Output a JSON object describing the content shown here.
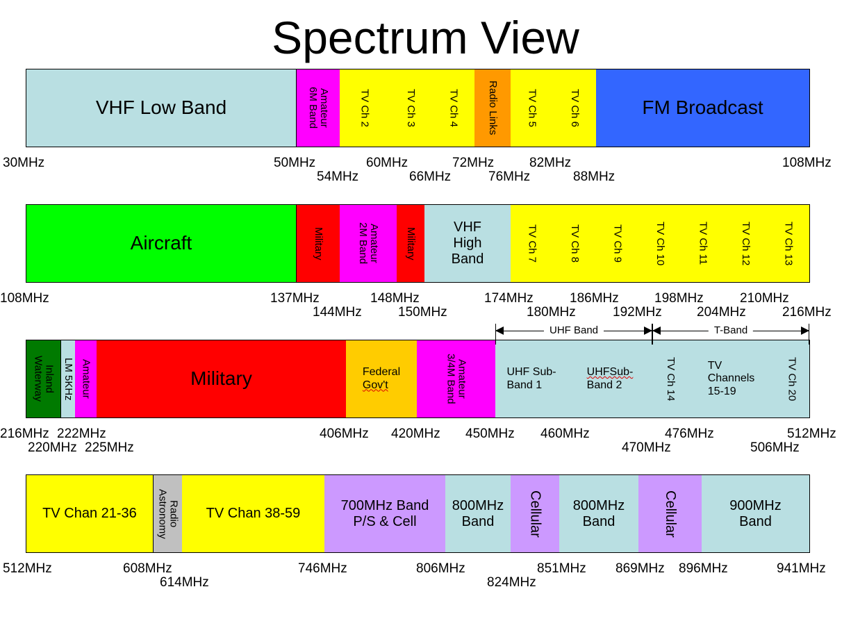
{
  "title": "Spectrum View",
  "colors": {
    "light_blue": "#b9dfe2",
    "magenta": "#ff00ff",
    "yellow": "#ffff00",
    "orange": "#ff9900",
    "fm_blue": "#3366ff",
    "green": "#00ff00",
    "red": "#ff0000",
    "dark_green": "#007a00",
    "gold": "#ffcc00",
    "lavender": "#cc99ff",
    "gray": "#c0c0c0"
  },
  "rows": [
    {
      "range": [
        "30MHz",
        "108MHz"
      ],
      "segments": [
        {
          "label": "VHF Low Band",
          "color": "light_blue",
          "orient": "horizontal",
          "size": "big"
        },
        {
          "label": "Amateur\n6M Band",
          "color": "magenta",
          "orient": "vertical"
        },
        {
          "label": "TV Ch 2",
          "color": "yellow",
          "orient": "vertical"
        },
        {
          "label": "TV Ch 3",
          "color": "yellow",
          "orient": "vertical"
        },
        {
          "label": "TV Ch 4",
          "color": "yellow",
          "orient": "vertical"
        },
        {
          "label": "Radio Links",
          "color": "orange",
          "orient": "vertical"
        },
        {
          "label": "TV Ch 5",
          "color": "yellow",
          "orient": "vertical"
        },
        {
          "label": "TV Ch 6",
          "color": "yellow",
          "orient": "vertical"
        },
        {
          "label": "FM Broadcast",
          "color": "fm_blue",
          "orient": "horizontal",
          "size": "big"
        }
      ],
      "freq_upper": [
        "30MHz",
        "50MHz",
        "60MHz",
        "72MHz",
        "82MHz",
        "108MHz"
      ],
      "freq_lower": [
        "54MHz",
        "66MHz",
        "76MHz",
        "88MHz"
      ]
    },
    {
      "range": [
        "108MHz",
        "216MHz"
      ],
      "segments": [
        {
          "label": "Aircraft",
          "color": "green",
          "orient": "horizontal",
          "size": "big"
        },
        {
          "label": "Military",
          "color": "red",
          "orient": "vertical"
        },
        {
          "label": "Amateur\n2M Band",
          "color": "magenta",
          "orient": "vertical"
        },
        {
          "label": "Military",
          "color": "red",
          "orient": "vertical"
        },
        {
          "label": "VHF\nHigh\nBand",
          "color": "light_blue",
          "orient": "horizontal",
          "size": "med"
        },
        {
          "label": "TV Ch 7",
          "color": "yellow",
          "orient": "vertical"
        },
        {
          "label": "TV Ch 8",
          "color": "yellow",
          "orient": "vertical"
        },
        {
          "label": "TV Ch 9",
          "color": "yellow",
          "orient": "vertical"
        },
        {
          "label": "TV Ch 10",
          "color": "yellow",
          "orient": "vertical"
        },
        {
          "label": "TV Ch 11",
          "color": "yellow",
          "orient": "vertical"
        },
        {
          "label": "TV Ch 12",
          "color": "yellow",
          "orient": "vertical"
        },
        {
          "label": "TV Ch 13",
          "color": "yellow",
          "orient": "vertical"
        }
      ],
      "freq_upper": [
        "108MHz",
        "137MHz",
        "148MHz",
        "174MHz",
        "186MHz",
        "198MHz",
        "210MHz"
      ],
      "freq_lower": [
        "144MHz",
        "150MHz",
        "180MHz",
        "192MHz",
        "204MHz",
        "216MHz"
      ]
    },
    {
      "range": [
        "216MHz",
        "512MHz"
      ],
      "brackets": [
        {
          "label": "UHF Band"
        },
        {
          "label": "T-Band"
        }
      ],
      "segments": [
        {
          "label": "Inland\nWaterway",
          "color": "dark_green",
          "orient": "vertical"
        },
        {
          "label": "LM 5KHz",
          "color": "light_blue",
          "orient": "vertical"
        },
        {
          "label": "Amateur",
          "color": "magenta",
          "orient": "vertical"
        },
        {
          "label": "Military",
          "color": "red",
          "orient": "horizontal",
          "size": "big"
        },
        {
          "label": "Federal\nGov't",
          "color": "gold",
          "orient": "horizontal",
          "size": "sm",
          "squiggle_line": 2
        },
        {
          "label": "Amateur\n3/4M Band",
          "color": "magenta",
          "orient": "vertical"
        },
        {
          "label": "UHF Sub-\nBand 1",
          "color": "light_blue",
          "orient": "horizontal",
          "size": "sm"
        },
        {
          "label": "UHFSub-\nBand 2",
          "color": "light_blue",
          "orient": "horizontal",
          "size": "sm",
          "squiggle_line": 1
        },
        {
          "label": "TV Ch 14",
          "color": "light_blue",
          "orient": "vertical"
        },
        {
          "label": "TV\nChannels\n15-19",
          "color": "light_blue",
          "orient": "horizontal",
          "size": "sm"
        },
        {
          "label": "TV Ch 20",
          "color": "light_blue",
          "orient": "vertical"
        }
      ],
      "freq_upper": [
        "216MHz",
        "222MHz",
        "406MHz",
        "420MHz",
        "450MHz",
        "460MHz",
        "476MHz",
        "512MHz"
      ],
      "freq_lower": [
        "220MHz",
        "225MHz",
        "470MHz",
        "506MHz"
      ]
    },
    {
      "range": [
        "512MHz",
        "941MHz"
      ],
      "segments": [
        {
          "label": "TV Chan 21-36",
          "color": "yellow",
          "orient": "horizontal",
          "size": "med"
        },
        {
          "label": "Radio\nAstronomy",
          "color": "gray",
          "orient": "vertical"
        },
        {
          "label": "TV Chan 38-59",
          "color": "yellow",
          "orient": "horizontal",
          "size": "med"
        },
        {
          "label": "700MHz Band\nP/S & Cell",
          "color": "lavender",
          "orient": "horizontal",
          "size": "med"
        },
        {
          "label": "800MHz\nBand",
          "color": "light_blue",
          "orient": "horizontal",
          "size": "med"
        },
        {
          "label": "Cellular",
          "color": "lavender",
          "orient": "vertical",
          "size": "med"
        },
        {
          "label": "800MHz\nBand",
          "color": "light_blue",
          "orient": "horizontal",
          "size": "med"
        },
        {
          "label": "Cellular",
          "color": "lavender",
          "orient": "vertical",
          "size": "med"
        },
        {
          "label": "900MHz\nBand",
          "color": "light_blue",
          "orient": "horizontal",
          "size": "med"
        }
      ],
      "freq_upper": [
        "512MHz",
        "608MHz",
        "746MHz",
        "806MHz",
        "851MHz",
        "869MHz",
        "896MHz",
        "941MHz"
      ],
      "freq_lower": [
        "614MHz",
        "824MHz"
      ]
    }
  ]
}
